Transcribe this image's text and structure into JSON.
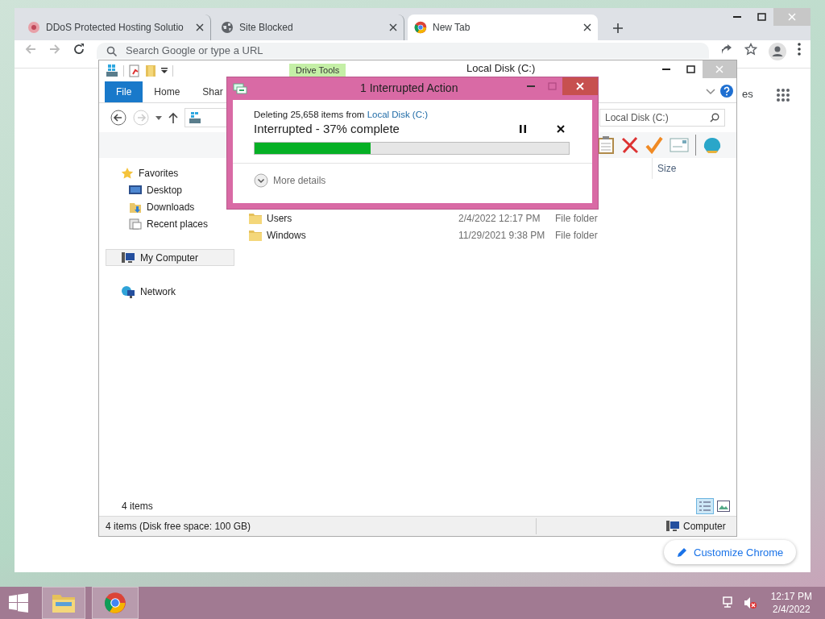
{
  "chrome": {
    "tabs": [
      {
        "label": "DDoS Protected Hosting Solutio",
        "kind": "flower",
        "selected": false
      },
      {
        "label": "Site Blocked",
        "kind": "globe",
        "selected": false
      },
      {
        "label": "New Tab",
        "kind": "chrome",
        "selected": true
      }
    ],
    "omnibox": {
      "placeholder": "Search Google or type a URL"
    },
    "partial_link": "es",
    "customize_button": "Customize Chrome"
  },
  "explorer": {
    "title": "Local Disk (C:)",
    "contextual_tab": "Drive Tools",
    "ribbon_tabs": [
      {
        "label": "File",
        "selected": true
      },
      {
        "label": "Home",
        "selected": false
      },
      {
        "label": "Shar",
        "selected": false
      }
    ],
    "search": {
      "placeholder": "Local Disk (C:)"
    },
    "column_header": "Size",
    "nav": [
      {
        "label": "Favorites",
        "kind": "star",
        "selected": false,
        "children": [
          {
            "label": "Desktop",
            "kind": "desktop",
            "selected": false
          },
          {
            "label": "Downloads",
            "kind": "downloads",
            "selected": false
          },
          {
            "label": "Recent places",
            "kind": "recent",
            "selected": false
          }
        ]
      },
      {
        "label": "My Computer",
        "kind": "computer",
        "selected": true
      },
      {
        "label": "Network",
        "kind": "network",
        "selected": false
      }
    ],
    "files": [
      {
        "name": "Users",
        "date": "2/4/2022 12:17 PM",
        "type": "File folder"
      },
      {
        "name": "Windows",
        "date": "11/29/2021 9:38 PM",
        "type": "File folder"
      }
    ],
    "item_count": "4 items",
    "status_bar": {
      "left": "4 items (Disk free space: 100 GB)",
      "right": "Computer"
    }
  },
  "dialog": {
    "title": "1 Interrupted Action",
    "message": "Deleting 25,658 items from ",
    "source_link": "Local Disk (C:)",
    "status": "Interrupted - 37% complete",
    "level": 0.37,
    "more_details": "More details"
  },
  "taskbar": {
    "time": "12:17 PM",
    "date": "2/4/2022"
  }
}
